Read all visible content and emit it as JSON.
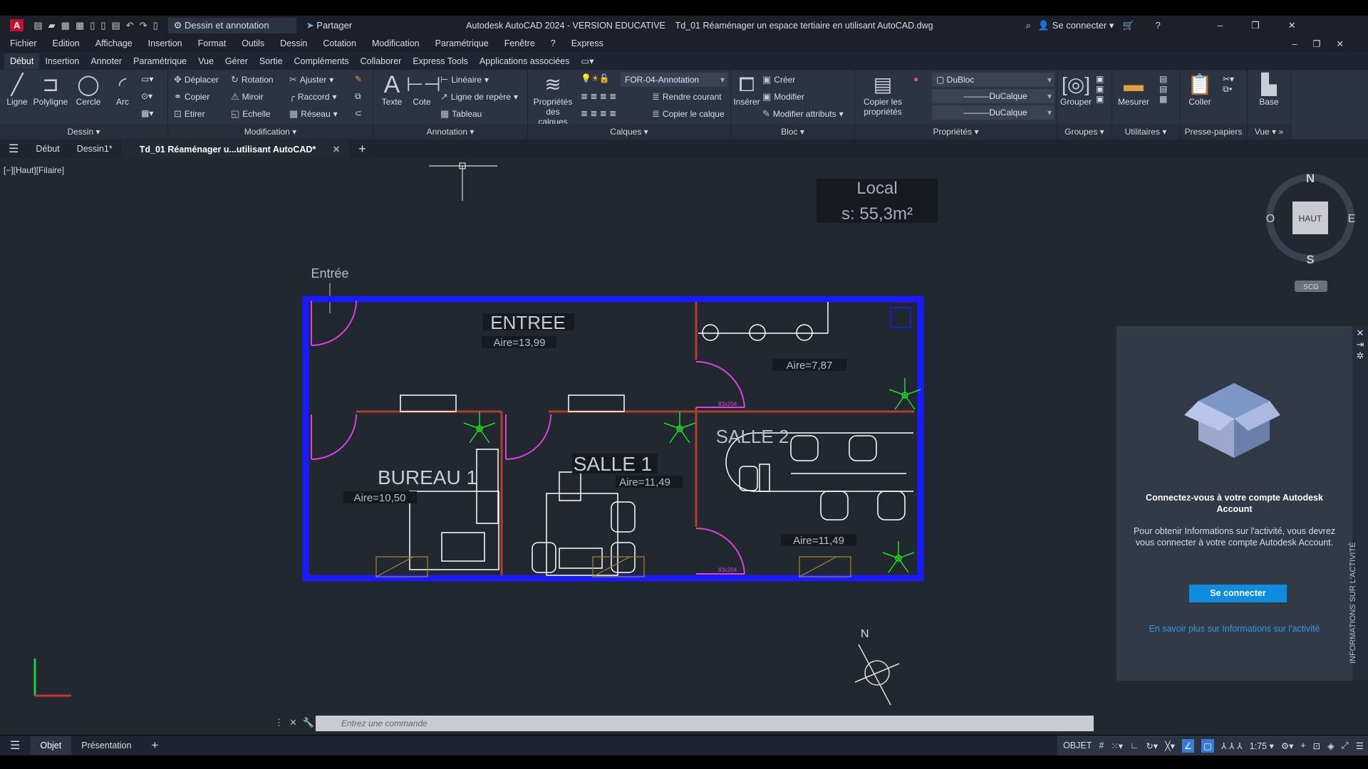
{
  "titlebar": {
    "workspace": "Dessin et annotation",
    "share": "Partager",
    "title": "Autodesk AutoCAD 2024 - VERSION EDUCATIVE    Td_01 Réaménager un espace tertiaire en utilisant AutoCAD.dwg",
    "signin": "Se connecter"
  },
  "menubar": [
    "Fichier",
    "Edition",
    "Affichage",
    "Insertion",
    "Format",
    "Outils",
    "Dessin",
    "Cotation",
    "Modification",
    "Paramétrique",
    "Fenêtre",
    "?",
    "Express"
  ],
  "ribbon_tabs": [
    "Début",
    "Insertion",
    "Annoter",
    "Paramétrique",
    "Vue",
    "Gérer",
    "Sortie",
    "Compléments",
    "Collaborer",
    "Express Tools",
    "Applications associées"
  ],
  "ribbon": {
    "dessin": {
      "title": "Dessin",
      "ligne": "Ligne",
      "polyligne": "Polyligne",
      "cercle": "Cercle",
      "arc": "Arc"
    },
    "modification": {
      "title": "Modification",
      "deplacer": "Déplacer",
      "rotation": "Rotation",
      "ajuster": "Ajuster",
      "copier": "Copier",
      "miroir": "Miroir",
      "raccord": "Raccord",
      "etirer": "Etirer",
      "echelle": "Echelle",
      "reseau": "Réseau"
    },
    "annotation": {
      "title": "Annotation",
      "texte": "Texte",
      "cote": "Cote",
      "lineaire": "Linéaire",
      "ligne_repere": "Ligne de repère",
      "tableau": "Tableau"
    },
    "calques": {
      "title": "Calques",
      "proprietes": "Propriétés des calques",
      "layer": "FOR-04-Annotation",
      "rendre_courant": "Rendre courant",
      "copier_calque": "Copier le calque"
    },
    "bloc": {
      "title": "Bloc",
      "inserer": "Insérer",
      "creer": "Créer",
      "modifier": "Modifier",
      "modifier_attributs": "Modifier attributs"
    },
    "proprietes": {
      "title": "Propriétés",
      "copier": "Copier les propriétés",
      "color": "DuBloc",
      "linetype": "DuCalque",
      "lineweight": "DuCalque"
    },
    "groupes": {
      "title": "Groupes",
      "grouper": "Grouper"
    },
    "utilitaires": {
      "title": "Utilitaires",
      "mesurer": "Mesurer"
    },
    "presse": {
      "title": "Presse-papiers",
      "coller": "Coller"
    },
    "vue": {
      "title": "Vue",
      "base": "Base"
    }
  },
  "doc_tabs": {
    "start": "Début",
    "dessin1": "Dessin1*",
    "active": "Td_01 Réaménager u...utilisant AutoCAD*"
  },
  "viewport_label": "[−][Haut][Filaire]",
  "drawing": {
    "entry": "Entrée",
    "local": "Local",
    "surface": "s: 55,3m²",
    "rooms": [
      {
        "name": "ENTREE",
        "area": "Aire=13,99"
      },
      {
        "name": "",
        "area": "Aire=7,87"
      },
      {
        "name": "BUREAU 1",
        "area": "Aire=10,50"
      },
      {
        "name": "SALLE 1",
        "area": "Aire=11,49"
      },
      {
        "name": "SALLE 2",
        "area": "Aire=11,49"
      }
    ],
    "door_label": "83x204",
    "colors": {
      "wall": "#1a1aff",
      "partition": "#b0402a",
      "door": "#e040e0",
      "plant": "#22dd22",
      "furniture": "#ffffff",
      "window": "#a08a2a"
    }
  },
  "viewcube": {
    "n": "N",
    "s": "S",
    "e": "E",
    "w": "O",
    "face": "HAUT",
    "scg": "SCG"
  },
  "command": {
    "placeholder": "Entrez une commande"
  },
  "statusbar": {
    "objet": "Objet",
    "presentation": "Présentation",
    "model": "OBJET",
    "scale": "1:75"
  },
  "activity_panel": {
    "heading": "Connectez-vous à votre compte Autodesk Account",
    "body": "Pour obtenir Informations sur l'activité, vous devrez vous connecter à votre compte Autodesk Account.",
    "button": "Se connecter",
    "link": "En savoir plus sur Informations sur l'activité",
    "side_label": "INFORMATIONS SUR L'ACTIVITÉ"
  }
}
